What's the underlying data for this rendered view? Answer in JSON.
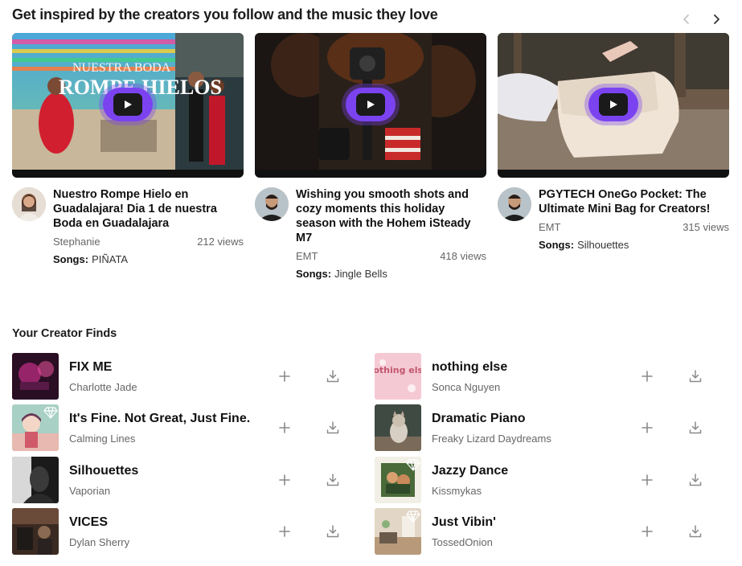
{
  "section": {
    "heading": "Get inspired by the creators you follow and the music they love"
  },
  "videos": [
    {
      "title": "Nuestro Rompe Hielo en Guadalajara! Dia 1 de nuestra Boda en Guadalajara",
      "creator": "Stephanie",
      "views": "212 views",
      "songs_label": "Songs:",
      "songs": "PIÑATA",
      "overlay_line1": "NUESTRA BODA",
      "overlay_line2": "ROMPE HIELOS"
    },
    {
      "title": "Wishing you smooth shots and cozy moments this holiday season with the Hohem iSteady M7",
      "creator": "EMT",
      "views": "418 views",
      "songs_label": "Songs:",
      "songs": "Jingle Bells"
    },
    {
      "title": "PGYTECH OneGo Pocket: The Ultimate Mini Bag for Creators!",
      "creator": "EMT",
      "views": "315 views",
      "songs_label": "Songs:",
      "songs": "Silhouettes"
    }
  ],
  "finds": {
    "heading": "Your Creator Finds",
    "left": [
      {
        "title": "FIX ME",
        "artist": "Charlotte Jade"
      },
      {
        "title": "It's Fine. Not Great, Just Fine.",
        "artist": "Calming Lines"
      },
      {
        "title": "Silhouettes",
        "artist": "Vaporian"
      },
      {
        "title": "VICES",
        "artist": "Dylan Sherry"
      }
    ],
    "right": [
      {
        "title": "nothing else",
        "artist": "Sonca Nguyen",
        "art_text": "nothing else"
      },
      {
        "title": "Dramatic Piano",
        "artist": "Freaky Lizard Daydreams"
      },
      {
        "title": "Jazzy Dance",
        "artist": "Kissmykas"
      },
      {
        "title": "Just Vibin'",
        "artist": "TossedOnion"
      }
    ]
  },
  "colors": {
    "play_button": "#7b43f0",
    "text_primary": "#1c1c1c",
    "text_secondary": "#666666",
    "icon_gray": "#8a8a8a"
  },
  "icons": [
    "chevron-left-icon",
    "chevron-right-icon",
    "play-icon",
    "plus-icon",
    "download-icon",
    "diamond-icon"
  ]
}
